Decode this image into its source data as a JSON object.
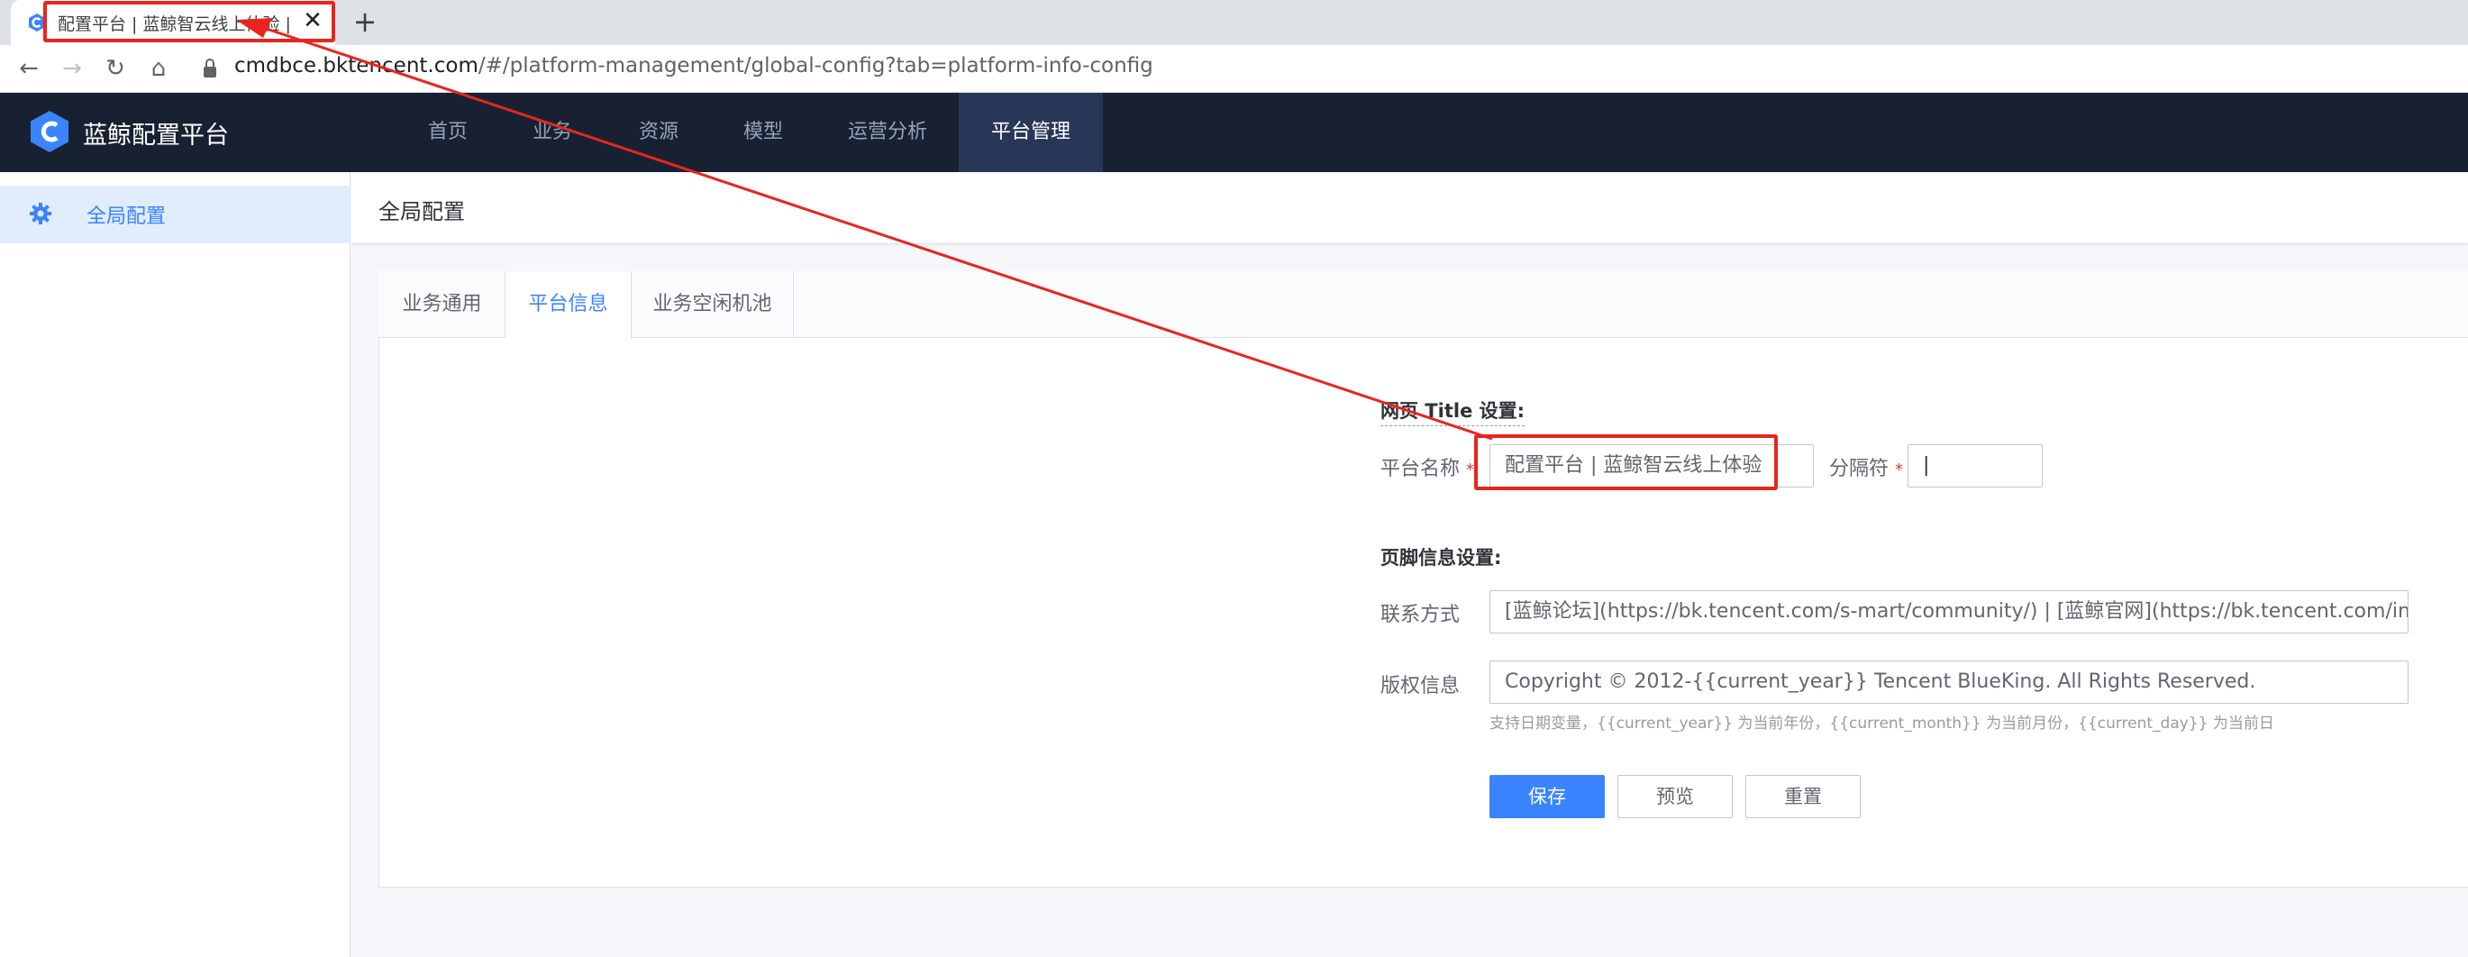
{
  "browser": {
    "tab_title": "配置平台 | 蓝鲸智云线上体验 | 平",
    "tab_close": "✕",
    "new_tab": "+",
    "url_host": "cmdb",
    "url_host_rest": "ce.bktencent.com",
    "url_path": "/#/platform-management/global-config?tab=platform-info-config",
    "back": "←",
    "forward": "→",
    "reload": "↻",
    "home": "⌂"
  },
  "header": {
    "brand": "蓝鲸配置平台",
    "nav": [
      "首页",
      "业务",
      "资源",
      "模型",
      "运营分析",
      "平台管理"
    ],
    "active_nav_index": 5
  },
  "sidebar": {
    "items": [
      {
        "label": "全局配置",
        "icon": "gear-icon",
        "active": true
      }
    ]
  },
  "page": {
    "title": "全局配置",
    "tabs": [
      "业务通用",
      "平台信息",
      "业务空闲机池"
    ],
    "active_tab_index": 1
  },
  "form": {
    "title_section": "网页 Title 设置:",
    "platform_name_label": "平台名称",
    "platform_name_value": "配置平台 | 蓝鲸智云线上体验",
    "separator_label": "分隔符",
    "separator_value": "|",
    "required_mark": "*",
    "footer_section": "页脚信息设置:",
    "contact_label": "联系方式",
    "contact_value": "[蓝鲸论坛](https://bk.tencent.com/s-mart/community/) | [蓝鲸官网](https://bk.tencent.com/index/)",
    "copyright_label": "版权信息",
    "copyright_value": "Copyright © 2012-{{current_year}} Tencent BlueKing. All Rights Reserved.",
    "hint": "支持日期变量，{{current_year}} 为当前年份，{{current_month}} 为当前月份，{{current_day}} 为当前日",
    "save": "保存",
    "preview": "预览",
    "reset": "重置"
  },
  "colors": {
    "primary": "#3a84ff",
    "header_bg": "#182132",
    "annotation": "#e8251d"
  }
}
